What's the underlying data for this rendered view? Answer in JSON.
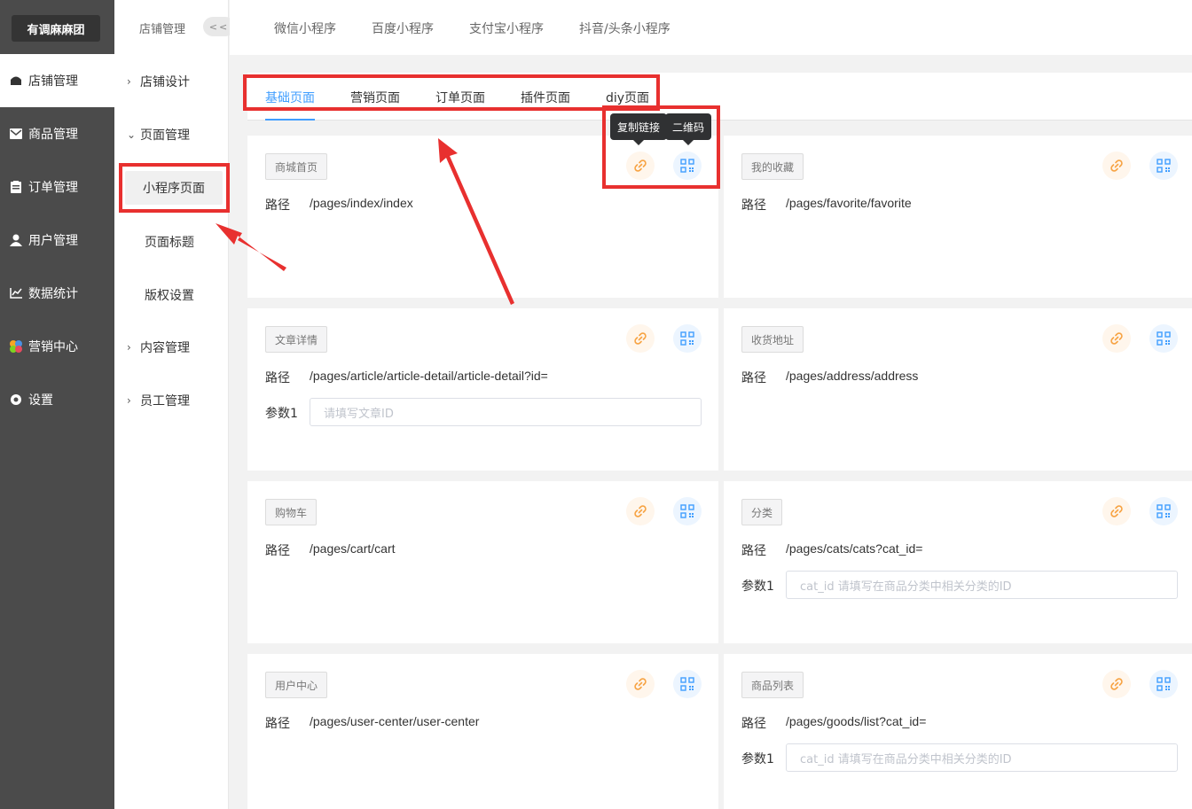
{
  "brand": "有调麻麻团",
  "nav": [
    {
      "label": "店铺管理",
      "icon": "shop-icon",
      "active": true
    },
    {
      "label": "商品管理",
      "icon": "mail-icon"
    },
    {
      "label": "订单管理",
      "icon": "order-icon"
    },
    {
      "label": "用户管理",
      "icon": "user-icon"
    },
    {
      "label": "数据统计",
      "icon": "chart-icon"
    },
    {
      "label": "营销中心",
      "icon": "marketing-icon"
    },
    {
      "label": "设置",
      "icon": "gear-icon"
    }
  ],
  "subnav": {
    "title": "店铺管理",
    "collapse": "<<",
    "items": [
      {
        "label": "店铺设计",
        "chevron": "›"
      },
      {
        "label": "页面管理",
        "chevron": "⌄"
      },
      {
        "label": "内容管理",
        "chevron": "›"
      },
      {
        "label": "员工管理",
        "chevron": "›"
      }
    ],
    "children": [
      "小程序页面",
      "页面标题",
      "版权设置"
    ]
  },
  "top_tabs": [
    "微信小程序",
    "百度小程序",
    "支付宝小程序",
    "抖音/头条小程序"
  ],
  "page_tabs": [
    "基础页面",
    "营销页面",
    "订单页面",
    "插件页面",
    "diy页面"
  ],
  "tooltips": {
    "copy_link": "复制链接",
    "qrcode": "二维码"
  },
  "path_label": "路径",
  "param_label": "参数1",
  "cards": [
    {
      "tag": "商城首页",
      "path": "/pages/index/index"
    },
    {
      "tag": "我的收藏",
      "path": "/pages/favorite/favorite"
    },
    {
      "tag": "文章详情",
      "path": "/pages/article/article-detail/article-detail?id=",
      "param_placeholder": "请填写文章ID"
    },
    {
      "tag": "收货地址",
      "path": "/pages/address/address"
    },
    {
      "tag": "购物车",
      "path": "/pages/cart/cart"
    },
    {
      "tag": "分类",
      "path": "/pages/cats/cats?cat_id=",
      "param_placeholder": "cat_id 请填写在商品分类中相关分类的ID"
    },
    {
      "tag": "用户中心",
      "path": "/pages/user-center/user-center"
    },
    {
      "tag": "商品列表",
      "path": "/pages/goods/list?cat_id=",
      "param_placeholder": "cat_id 请填写在商品分类中相关分类的ID"
    }
  ],
  "colors": {
    "accent": "#409eff",
    "annotation": "#e8302f",
    "sidebar": "#4b4b4b"
  }
}
